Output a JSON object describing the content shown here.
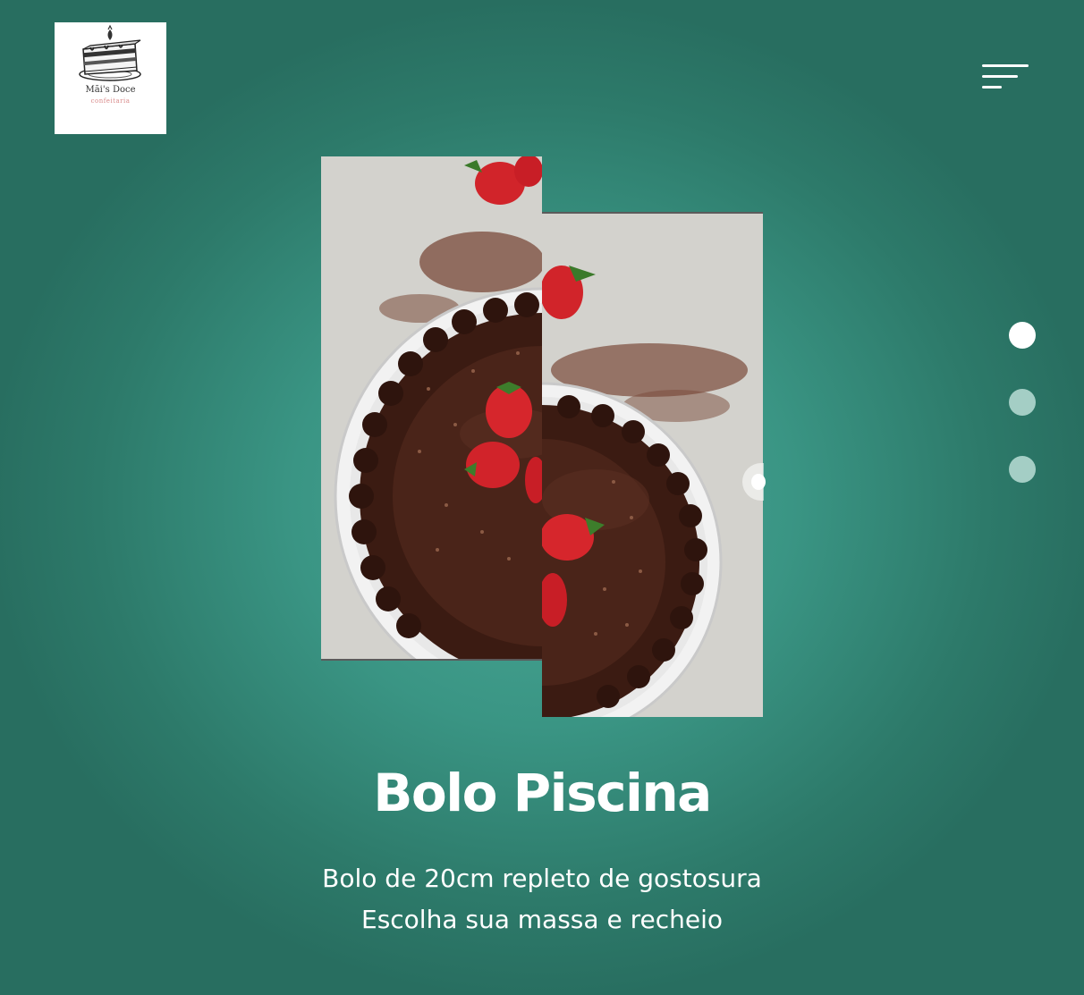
{
  "brand": {
    "name": "Mãi's Doce",
    "tagline": "confeitaria",
    "logo_icon": "cake-slice-icon"
  },
  "nav": {
    "menu_icon": "hamburger-menu-icon"
  },
  "carousel": {
    "active_index": 0,
    "total": 3,
    "dots": [
      {
        "active": true,
        "color": "#ffffff"
      },
      {
        "active": false,
        "color": "#a4cec5"
      },
      {
        "active": false,
        "color": "#a4cec5"
      }
    ]
  },
  "product": {
    "image_subject": "chocolate pool cake with strawberries and sprinkles",
    "title": "Bolo Piscina",
    "description_line1": "Bolo de 20cm repleto de gostosura",
    "description_line2": "Escolha sua massa e recheio"
  },
  "colors": {
    "background_center": "#4aa896",
    "background_edge": "#286e60",
    "text": "#ffffff"
  }
}
